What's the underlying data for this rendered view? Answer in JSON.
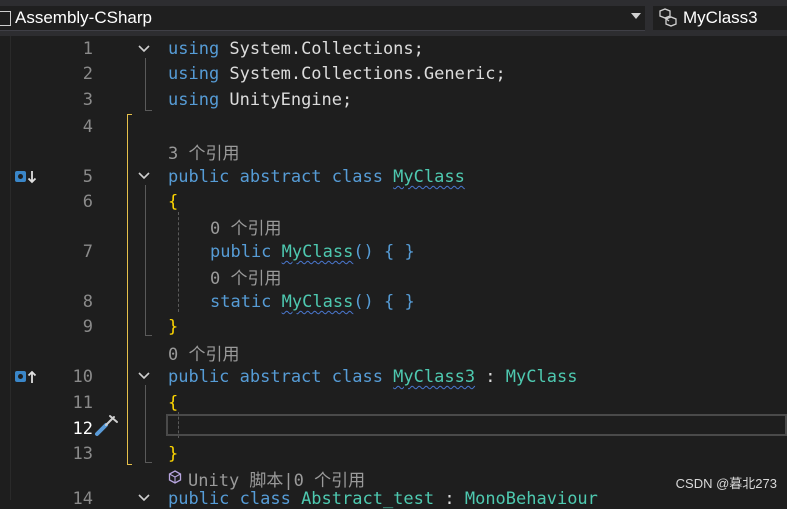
{
  "toolbar": {
    "project_label": "Assembly-CSharp",
    "member_label": "MyClass3",
    "project_icon": "project-icon",
    "member_icon": "class-members-icon"
  },
  "lines": [
    {
      "num": "1"
    },
    {
      "num": "2"
    },
    {
      "num": "3"
    },
    {
      "num": "4"
    },
    {
      "num": "5"
    },
    {
      "num": "6"
    },
    {
      "num": "7"
    },
    {
      "num": "8"
    },
    {
      "num": "9"
    },
    {
      "num": "10"
    },
    {
      "num": "11"
    },
    {
      "num": "12"
    },
    {
      "num": "13"
    },
    {
      "num": "14"
    }
  ],
  "code": {
    "l1_kw": "using",
    "l1_rest": " System.Collections;",
    "l2_kw": "using",
    "l2_rest": " System.Collections.Generic;",
    "l3_kw": "using",
    "l3_rest": " UnityEngine;",
    "l5_kw": "public abstract class ",
    "l5_type": "MyClass",
    "l6_brace": "{",
    "l7_kw": "public ",
    "l7_type": "MyClass",
    "l7_rest": "() { }",
    "l8_kw": "static ",
    "l8_type": "MyClass",
    "l8_rest": "() { }",
    "l9_brace": "}",
    "l10_kw": "public abstract class ",
    "l10_type": "MyClass3",
    "l10_sep": " : ",
    "l10_base": "MyClass",
    "l11_brace": "{",
    "l13_brace": "}",
    "l14_kw": "public class ",
    "l14_type": "Abstract_test",
    "l14_sep": " : ",
    "l14_base": "MonoBehaviour"
  },
  "lens": {
    "myclass": "3 个引用",
    "ctor": "0 个引用",
    "static_ctor": "0 个引用",
    "myclass3": "0 个引用",
    "abstract_test": "Unity 脚本|0 个引用"
  },
  "watermark": "CSDN @暮北273",
  "colors": {
    "keyword": "#569cd6",
    "type": "#4ec9b0",
    "brace": "#ffd700",
    "text": "#dcdcdc",
    "background": "#1e1e1e"
  }
}
